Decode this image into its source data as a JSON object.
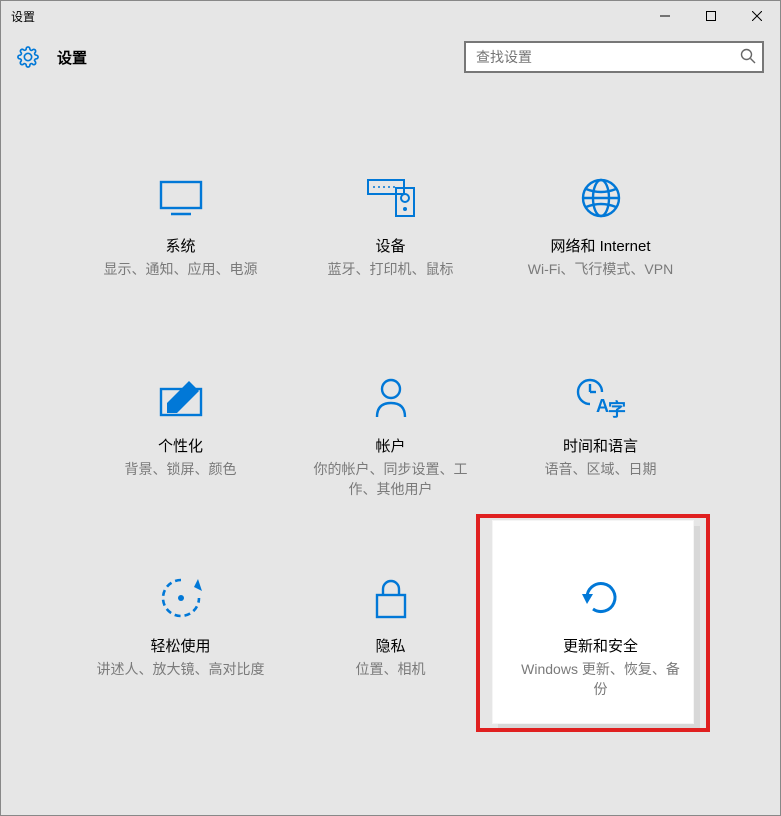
{
  "window": {
    "title": "设置",
    "app_label": "设置"
  },
  "search": {
    "placeholder": "查找设置"
  },
  "accent_color": "#0178d7",
  "tiles": [
    {
      "title": "系统",
      "desc": "显示、通知、应用、电源"
    },
    {
      "title": "设备",
      "desc": "蓝牙、打印机、鼠标"
    },
    {
      "title": "网络和 Internet",
      "desc": "Wi-Fi、飞行模式、VPN"
    },
    {
      "title": "个性化",
      "desc": "背景、锁屏、颜色"
    },
    {
      "title": "帐户",
      "desc": "你的帐户、同步设置、工作、其他用户"
    },
    {
      "title": "时间和语言",
      "desc": "语音、区域、日期"
    },
    {
      "title": "轻松使用",
      "desc": "讲述人、放大镜、高对比度"
    },
    {
      "title": "隐私",
      "desc": "位置、相机"
    },
    {
      "title": "更新和安全",
      "desc": "Windows 更新、恢复、备份"
    }
  ]
}
